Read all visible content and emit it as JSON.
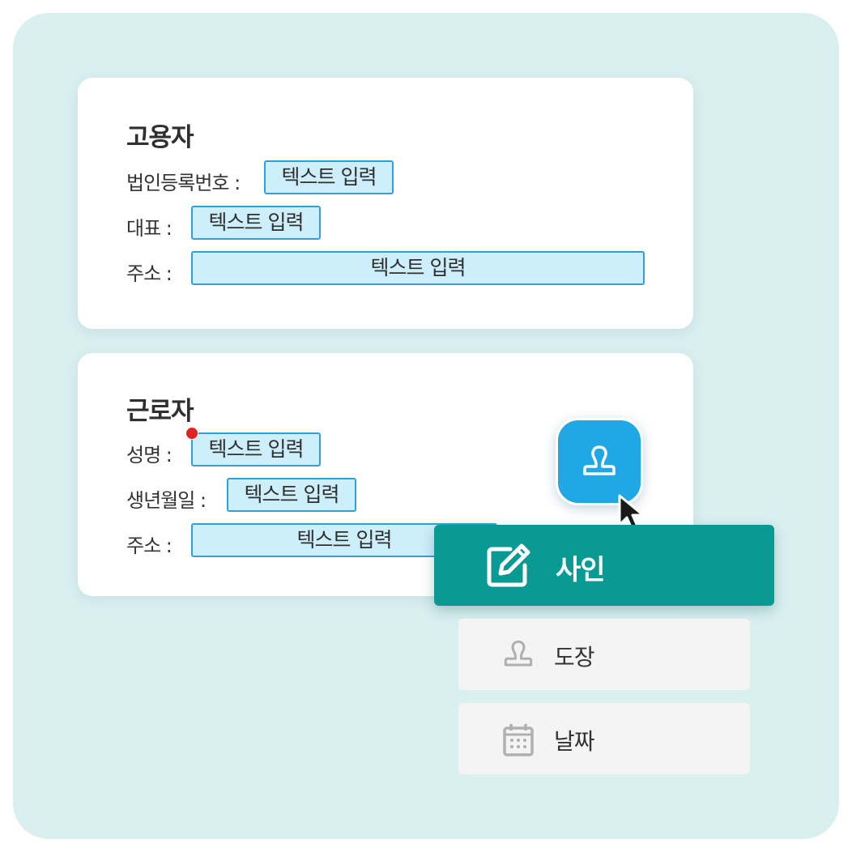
{
  "employer": {
    "title": "고용자",
    "fields": [
      {
        "label": "법인등록번호 :",
        "placeholder": "텍스트 입력"
      },
      {
        "label": "대표 :",
        "placeholder": "텍스트 입력"
      },
      {
        "label": "주소 :",
        "placeholder": "텍스트 입력"
      }
    ]
  },
  "worker": {
    "title": "근로자",
    "fields": [
      {
        "label": "성명 :",
        "placeholder": "텍스트 입력"
      },
      {
        "label": "생년월일 :",
        "placeholder": "텍스트 입력"
      },
      {
        "label": "주소 :",
        "placeholder": "텍스트 입력"
      }
    ]
  },
  "floating_button": {
    "icon": "stamp-icon"
  },
  "menu": {
    "items": [
      {
        "label": "사인",
        "icon": "edit-icon",
        "active": true
      },
      {
        "label": "도장",
        "icon": "stamp-icon",
        "active": false
      },
      {
        "label": "날짜",
        "icon": "calendar-icon",
        "active": false
      }
    ]
  },
  "colors": {
    "background": "#d9eff0",
    "input_fill": "#cdeefb",
    "input_border": "#2aa3dc",
    "stamp_button": "#1fa8e3",
    "menu_active": "#0a9a94",
    "menu_inactive": "#f4f4f4",
    "required_dot": "#e02323"
  }
}
